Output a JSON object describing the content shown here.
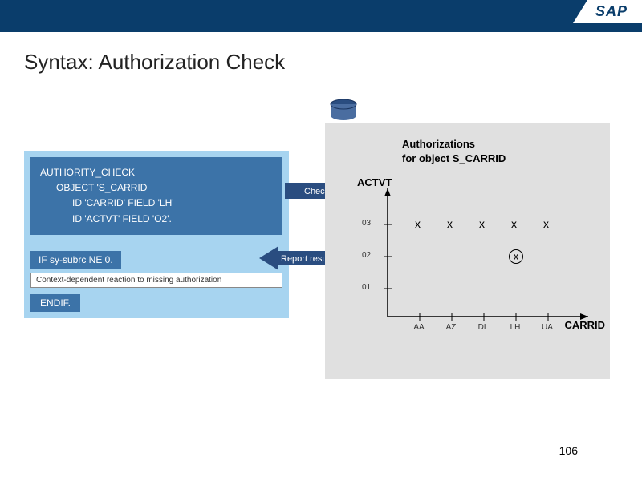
{
  "logo": "SAP",
  "title": "Syntax: Authorization Check",
  "code": {
    "l1": "AUTHORITY_CHECK",
    "l2": "      OBJECT 'S_CARRID'",
    "l3": "            ID 'CARRID' FIELD 'LH'",
    "l4": "            ID 'ACTVT' FIELD 'O2'.",
    "if": "IF sy-subrc NE 0.",
    "context": "Context-dependent reaction to missing authorization",
    "endif": "ENDIF."
  },
  "arrows": {
    "check": "Check",
    "report": "Report results"
  },
  "chart": {
    "title1": "Authorizations",
    "title2": "for object S_CARRID",
    "ylabel": "ACTVT",
    "xlabel": "CARRID"
  },
  "chart_data": {
    "type": "scatter",
    "x_categories": [
      "AA",
      "AZ",
      "DL",
      "LH",
      "UA"
    ],
    "y_categories": [
      "01",
      "02",
      "03"
    ],
    "points": [
      {
        "x": "AA",
        "y": "03",
        "mark": "x"
      },
      {
        "x": "AZ",
        "y": "03",
        "mark": "x"
      },
      {
        "x": "DL",
        "y": "03",
        "mark": "x"
      },
      {
        "x": "LH",
        "y": "03",
        "mark": "x"
      },
      {
        "x": "UA",
        "y": "03",
        "mark": "x"
      },
      {
        "x": "LH",
        "y": "02",
        "mark": "circled-x"
      }
    ],
    "xlabel": "CARRID",
    "ylabel": "ACTVT"
  },
  "page_number": "106"
}
